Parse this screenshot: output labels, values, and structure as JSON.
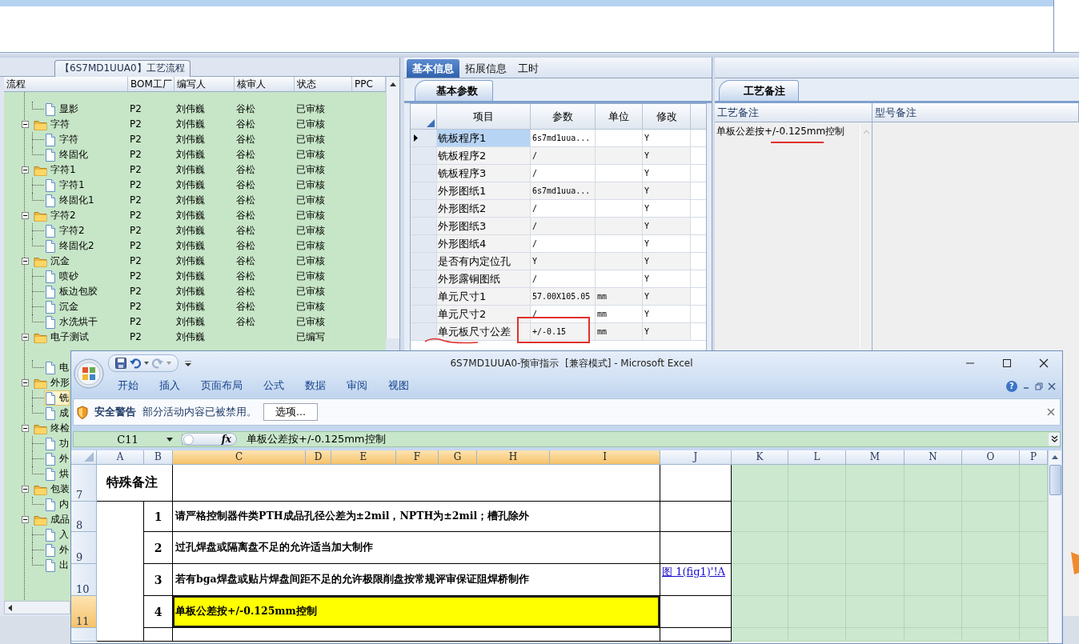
{
  "process_panel": {
    "title": "【6S7MD1UUA0】工艺流程",
    "columns": [
      "流程",
      "BOM工厂",
      "编写人",
      "核审人",
      "状态",
      "PPC"
    ],
    "tree": [
      {
        "children": [
          {
            "name": "显影",
            "bom": "P2",
            "writer": "刘伟巍",
            "reviewer": "谷松",
            "status": "已审核",
            "selected": false
          }
        ]
      },
      {
        "name": "字符",
        "expanded": true,
        "selected": false,
        "bom": "P2",
        "writer": "刘伟巍",
        "reviewer": "谷松",
        "status": "已审核",
        "children": [
          {
            "name": "字符",
            "bom": "P2",
            "writer": "刘伟巍",
            "reviewer": "谷松",
            "status": "已审核",
            "selected": false
          },
          {
            "name": "终固化",
            "bom": "P2",
            "writer": "刘伟巍",
            "reviewer": "谷松",
            "status": "已审核",
            "selected": false
          }
        ]
      },
      {
        "name": "字符1",
        "expanded": true,
        "selected": false,
        "bom": "P2",
        "writer": "刘伟巍",
        "reviewer": "谷松",
        "status": "已审核",
        "children": [
          {
            "name": "字符1",
            "bom": "P2",
            "writer": "刘伟巍",
            "reviewer": "谷松",
            "status": "已审核",
            "selected": false
          },
          {
            "name": "终固化1",
            "bom": "P2",
            "writer": "刘伟巍",
            "reviewer": "谷松",
            "status": "已审核",
            "selected": false
          }
        ]
      },
      {
        "name": "字符2",
        "expanded": true,
        "selected": false,
        "bom": "P2",
        "writer": "刘伟巍",
        "reviewer": "谷松",
        "status": "已审核",
        "children": [
          {
            "name": "字符2",
            "bom": "P2",
            "writer": "刘伟巍",
            "reviewer": "谷松",
            "status": "已审核",
            "selected": false
          },
          {
            "name": "终固化2",
            "bom": "P2",
            "writer": "刘伟巍",
            "reviewer": "谷松",
            "status": "已审核",
            "selected": false
          }
        ]
      },
      {
        "name": "沉金",
        "expanded": true,
        "selected": false,
        "bom": "P2",
        "writer": "刘伟巍",
        "reviewer": "谷松",
        "status": "已审核",
        "children": [
          {
            "name": "喷砂",
            "bom": "P2",
            "writer": "刘伟巍",
            "reviewer": "谷松",
            "status": "已审核",
            "selected": false
          },
          {
            "name": "板边包胶",
            "bom": "P2",
            "writer": "刘伟巍",
            "reviewer": "谷松",
            "status": "已审核",
            "selected": false
          },
          {
            "name": "沉金",
            "bom": "P2",
            "writer": "刘伟巍",
            "reviewer": "谷松",
            "status": "已审核",
            "selected": false
          },
          {
            "name": "水洗烘干",
            "bom": "P2",
            "writer": "刘伟巍",
            "reviewer": "谷松",
            "status": "已审核",
            "selected": false
          }
        ]
      },
      {
        "name": "电子测试",
        "expanded": true,
        "selected": false,
        "bom": "P2",
        "writer": "刘伟巍",
        "status": "已编写",
        "children": [
          {
            "name": "电",
            "selected": false
          }
        ]
      },
      {
        "name": "外形",
        "expanded": true,
        "selected": false,
        "children": [
          {
            "name": "铣",
            "selected": true
          },
          {
            "name": "成",
            "selected": false
          }
        ]
      },
      {
        "name": "终检",
        "expanded": true,
        "selected": false,
        "children": [
          {
            "name": "功",
            "selected": false
          },
          {
            "name": "外",
            "selected": false
          },
          {
            "name": "烘",
            "selected": false
          }
        ]
      },
      {
        "name": "包装",
        "expanded": true,
        "selected": false,
        "children": [
          {
            "name": "内",
            "selected": false
          }
        ]
      },
      {
        "name": "成品",
        "expanded": true,
        "selected": false,
        "children": [
          {
            "name": "入",
            "selected": false
          },
          {
            "name": "外",
            "selected": false
          },
          {
            "name": "出",
            "selected": false
          }
        ]
      }
    ]
  },
  "detail_panel": {
    "tabs": [
      {
        "label": "基本信息",
        "selected": true
      },
      {
        "label": "拓展信息",
        "selected": false
      },
      {
        "label": "工时",
        "selected": false
      }
    ],
    "section_tab": "基本参数",
    "columns": [
      "项目",
      "参数",
      "单位",
      "修改"
    ],
    "rows": [
      {
        "item": "铣板程序1",
        "param": "6s7md1uua...",
        "modify": "Y",
        "selected": true
      },
      {
        "item": "铣板程序2",
        "param": "/",
        "modify": "Y",
        "selected": false
      },
      {
        "item": "铣板程序3",
        "param": "/",
        "modify": "Y",
        "selected": false
      },
      {
        "item": "外形图纸1",
        "param": "6s7md1uua...",
        "modify": "Y",
        "selected": false
      },
      {
        "item": "外形图纸2",
        "param": "/",
        "modify": "Y",
        "selected": false
      },
      {
        "item": "外形图纸3",
        "param": "/",
        "modify": "Y",
        "selected": false
      },
      {
        "item": "外形图纸4",
        "param": "/",
        "modify": "Y",
        "selected": false
      },
      {
        "item": "是否有内定位孔",
        "param": "Y",
        "modify": "Y",
        "selected": false
      },
      {
        "item": "外形露铜图纸",
        "param": "/",
        "modify": "Y",
        "selected": false
      },
      {
        "item": "单元尺寸1",
        "param": "57.00X105.05",
        "unit": "mm",
        "modify": "Y",
        "selected": false
      },
      {
        "item": "单元尺寸2",
        "param": "/",
        "unit": "mm",
        "modify": "Y",
        "selected": false
      },
      {
        "item": "单元板尺寸公差",
        "param": "+/-0.15",
        "unit": "mm",
        "modify": "Y",
        "selected": false
      }
    ]
  },
  "notes_panel": {
    "section_tab": "工艺备注",
    "columns": [
      "工艺备注",
      "型号备注"
    ],
    "process_note": "单板公差按+/-0.125mm控制"
  },
  "excel": {
    "title": "6S7MD1UUA0-预审指示  [兼容模式] - Microsoft Excel",
    "ribbon_tabs": [
      "开始",
      "插入",
      "页面布局",
      "公式",
      "数据",
      "审阅",
      "视图"
    ],
    "help_button": "?",
    "security_bar": {
      "label": "安全警告",
      "message": "部分活动内容已被禁用。",
      "button": "选项..."
    },
    "name_box": "C11",
    "function_button": "fx",
    "formula": "单板公差按+/-0.125mm控制",
    "columns": [
      {
        "label": "A",
        "selected": false
      },
      {
        "label": "B",
        "selected": false
      },
      {
        "label": "C",
        "selected": true
      },
      {
        "label": "D",
        "selected": true
      },
      {
        "label": "E",
        "selected": true
      },
      {
        "label": "F",
        "selected": true
      },
      {
        "label": "G",
        "selected": true
      },
      {
        "label": "H",
        "selected": true
      },
      {
        "label": "I",
        "selected": true
      },
      {
        "label": "J",
        "selected": false
      },
      {
        "label": "K",
        "selected": false
      },
      {
        "label": "L",
        "selected": false
      },
      {
        "label": "M",
        "selected": false
      },
      {
        "label": "N",
        "selected": false
      },
      {
        "label": "O",
        "selected": false
      },
      {
        "label": "P",
        "selected": false
      }
    ],
    "rows": [
      {
        "number": "7",
        "selected": false,
        "label": "特殊备注"
      },
      {
        "number": "8",
        "selected": false,
        "index": "1",
        "text": "请严格控制器件类PTH成品孔径公差为±2mil，NPTH为±2mil；槽孔除外",
        "highlighted": false
      },
      {
        "number": "9",
        "selected": false,
        "index": "2",
        "text": "过孔焊盘或隔离盘不足的允许适当加大制作",
        "highlighted": false
      },
      {
        "number": "10",
        "selected": false,
        "index": "3",
        "text": "若有bga焊盘或贴片焊盘间距不足的允许极限削盘按常规评审保证阻焊桥制作",
        "highlighted": false,
        "link": "图 1(fig1)'!A"
      },
      {
        "number": "11",
        "selected": true,
        "index": "4",
        "text": "单板公差按+/-0.125mm控制",
        "highlighted": true
      },
      {
        "selected": false,
        "highlighted": false
      }
    ]
  }
}
